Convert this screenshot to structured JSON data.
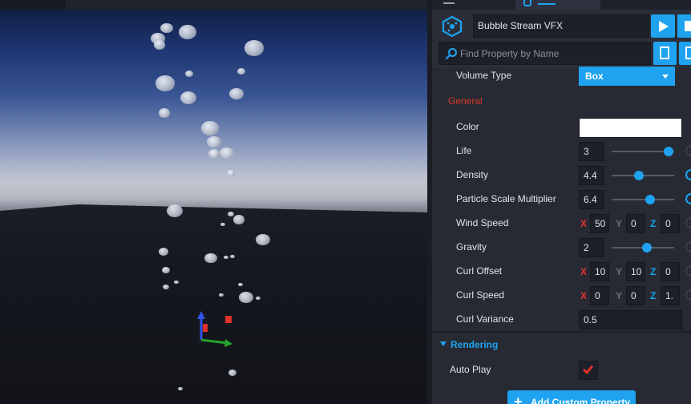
{
  "object": {
    "name": "Bubble Stream VFX",
    "search_placeholder": "Find Property by Name"
  },
  "properties": {
    "volume_type": {
      "label": "Volume Type",
      "value": "Box"
    },
    "general_label": "General",
    "color": {
      "label": "Color",
      "value": "#ffffff"
    },
    "life": {
      "label": "Life",
      "value": "3",
      "slider": 0.91
    },
    "density": {
      "label": "Density",
      "value": "4.4",
      "slider": 0.44
    },
    "particle_scale": {
      "label": "Particle Scale Multiplier",
      "value": "6.4",
      "slider": 0.62
    },
    "wind_speed": {
      "label": "Wind Speed",
      "x": "50",
      "y": "0",
      "z": "0"
    },
    "gravity": {
      "label": "Gravity",
      "value": "2",
      "slider": 0.57
    },
    "curl_offset": {
      "label": "Curl Offset",
      "x": "10",
      "y": "10",
      "z": "0"
    },
    "curl_speed": {
      "label": "Curl Speed",
      "x": "0",
      "y": "0",
      "z": "1."
    },
    "curl_variance": {
      "label": "Curl Variance",
      "value": "0.5"
    },
    "axis_labels": {
      "x": "X",
      "y": "Y",
      "z": "Z"
    }
  },
  "rendering": {
    "label": "Rendering",
    "auto_play": {
      "label": "Auto Play",
      "checked": true
    }
  },
  "add_button": {
    "label": "Add Custom Property"
  },
  "colors": {
    "accent": "#1fa3f0",
    "general_red": "#d9382b",
    "panel_bg": "#272a33"
  },
  "icons": [
    "vfx-object-icon",
    "play-icon",
    "stop-icon",
    "search-icon",
    "document-icon",
    "reset-icon",
    "chevron-down-icon",
    "checkmark-icon",
    "plus-icon",
    "transform-gizmo-icon"
  ]
}
